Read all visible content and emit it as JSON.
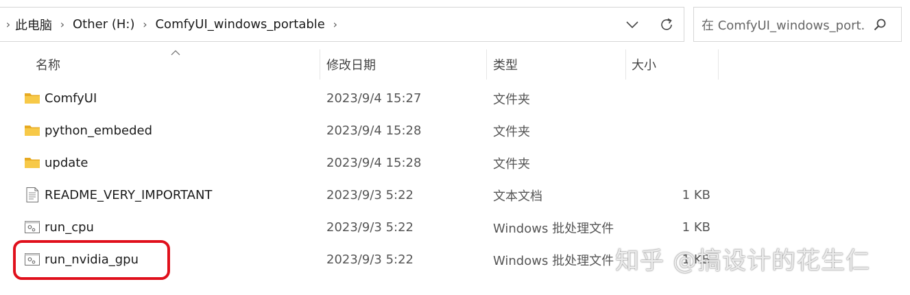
{
  "address": {
    "breadcrumbs": [
      "此电脑",
      "Other (H:)",
      "ComfyUI_windows_portable"
    ],
    "dropdown_icon": "chevron-down-icon",
    "refresh_icon": "refresh-icon"
  },
  "search": {
    "placeholder": "在 ComfyUI_windows_port...",
    "icon": "search-icon"
  },
  "columns": {
    "name": "名称",
    "modified": "修改日期",
    "type": "类型",
    "size": "大小",
    "sort_icon": "sort-up-icon"
  },
  "files": [
    {
      "name": "ComfyUI",
      "modified": "2023/9/4 15:27",
      "type": "文件夹",
      "size": "",
      "icon": "folder-icon"
    },
    {
      "name": "python_embeded",
      "modified": "2023/9/4 15:28",
      "type": "文件夹",
      "size": "",
      "icon": "folder-icon"
    },
    {
      "name": "update",
      "modified": "2023/9/4 15:28",
      "type": "文件夹",
      "size": "",
      "icon": "folder-icon"
    },
    {
      "name": "README_VERY_IMPORTANT",
      "modified": "2023/9/3 5:22",
      "type": "文本文档",
      "size": "1 KB",
      "icon": "text-file-icon"
    },
    {
      "name": "run_cpu",
      "modified": "2023/9/3 5:22",
      "type": "Windows 批处理文件",
      "size": "1 KB",
      "icon": "batch-file-icon"
    },
    {
      "name": "run_nvidia_gpu",
      "modified": "2023/9/3 5:22",
      "type": "Windows 批处理文件",
      "size": "1 KB",
      "icon": "batch-file-icon"
    }
  ],
  "watermark": "知乎 @搞设计的花生仁",
  "colors": {
    "highlight": "#e0101c",
    "folder": "#f7c948"
  }
}
